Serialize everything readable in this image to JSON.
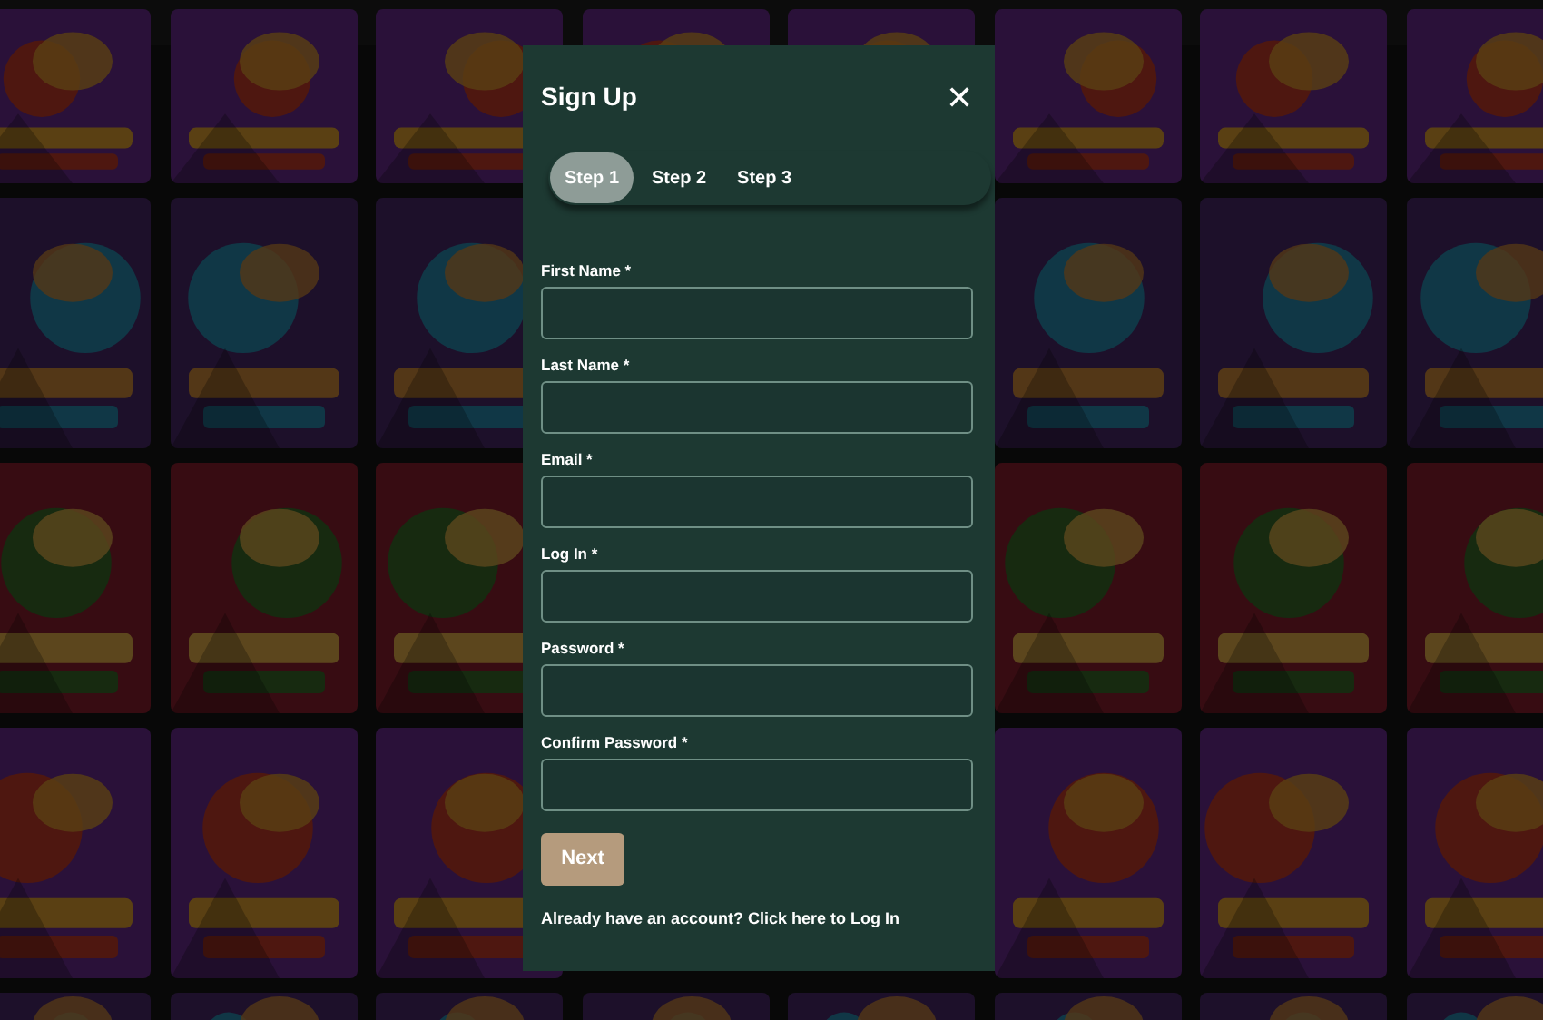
{
  "dialog": {
    "title": "Sign Up",
    "close": "✕"
  },
  "steps": [
    {
      "label": "Step 1",
      "selected": true
    },
    {
      "label": "Step 2",
      "selected": false
    },
    {
      "label": "Step 3",
      "selected": false
    }
  ],
  "fields": [
    {
      "label": "First Name *"
    },
    {
      "label": "Last Name *"
    },
    {
      "label": "Email *"
    },
    {
      "label": "Log In *"
    },
    {
      "label": "Password *"
    },
    {
      "label": "Confirm Password *"
    }
  ],
  "next_button": "Next",
  "login_prompt": "Already have an account? Click here to Log In"
}
